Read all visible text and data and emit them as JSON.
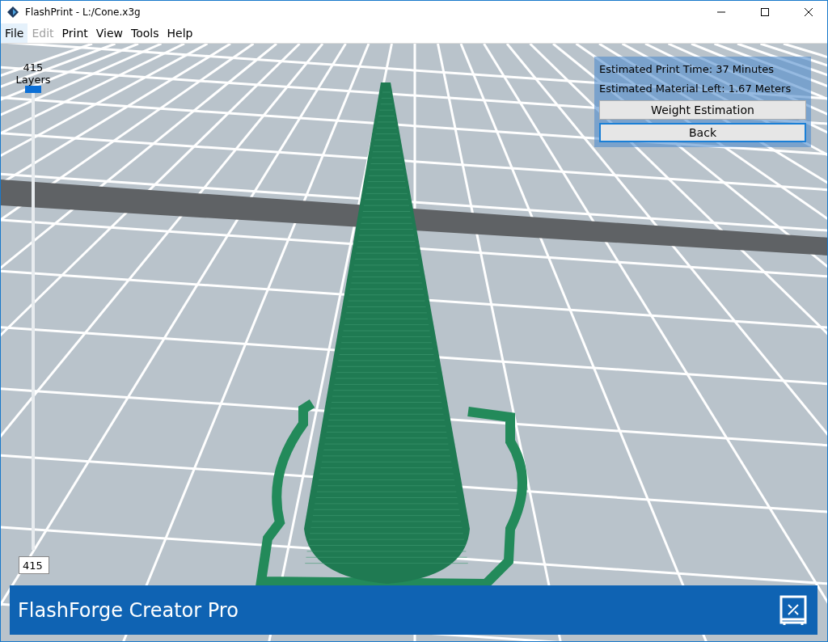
{
  "window": {
    "title": "FlashPrint - L:/Cone.x3g"
  },
  "menu": [
    {
      "label": "File",
      "selected": true,
      "disabled": false
    },
    {
      "label": "Edit",
      "selected": false,
      "disabled": true
    },
    {
      "label": "Print",
      "selected": false,
      "disabled": false
    },
    {
      "label": "View",
      "selected": false,
      "disabled": false
    },
    {
      "label": "Tools",
      "selected": false,
      "disabled": false
    },
    {
      "label": "Help",
      "selected": false,
      "disabled": false
    }
  ],
  "layer_slider": {
    "count": "415",
    "label": "Layers",
    "level": 1,
    "value": "415"
  },
  "estimate_panel": {
    "lines": [
      "Estimated Print Time: 37 Minutes",
      "Estimated Material Left: 1.67 Meters"
    ],
    "buttons": [
      {
        "label": "Weight Estimation",
        "selected": false
      },
      {
        "label": "Back",
        "selected": true
      }
    ]
  },
  "status_bar": {
    "printer": "FlashForge Creator Pro"
  }
}
